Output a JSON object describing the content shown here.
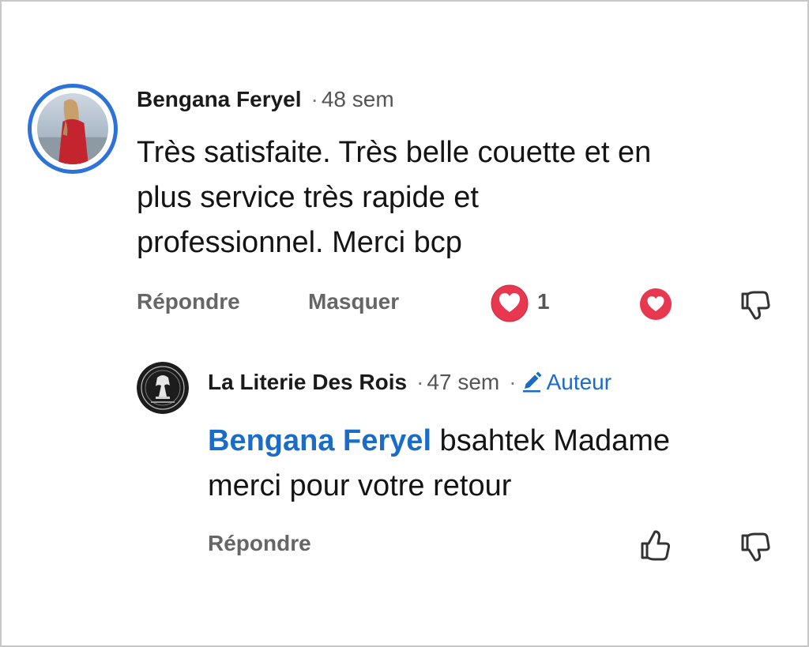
{
  "comment": {
    "author": "Bengana Feryel",
    "time": "48 sem",
    "text_lines": [
      "Très satisfaite. Très belle couette et en",
      "plus service très rapide et",
      "professionnel. Merci bcp"
    ],
    "actions": {
      "reply_label": "Répondre",
      "hide_label": "Masquer",
      "reaction_count": "1"
    },
    "icons": {
      "reaction": "heart-reaction-icon",
      "heart": "heart-icon",
      "dislike": "thumbs-down-icon"
    }
  },
  "reply": {
    "author": "La Literie Des Rois",
    "time": "47 sem",
    "badge_label": "Auteur",
    "mention": "Bengana Feryel",
    "text_first": " bsahtek Madame",
    "text_second": "merci pour votre retour",
    "actions": {
      "reply_label": "Répondre"
    },
    "icons": {
      "badge": "pencil-icon",
      "like": "thumbs-up-icon",
      "dislike": "thumbs-down-icon"
    }
  },
  "colors": {
    "link_blue": "#1a6cc7",
    "avatar_ring": "#2d72d8",
    "reaction_red": "#e8384f"
  }
}
